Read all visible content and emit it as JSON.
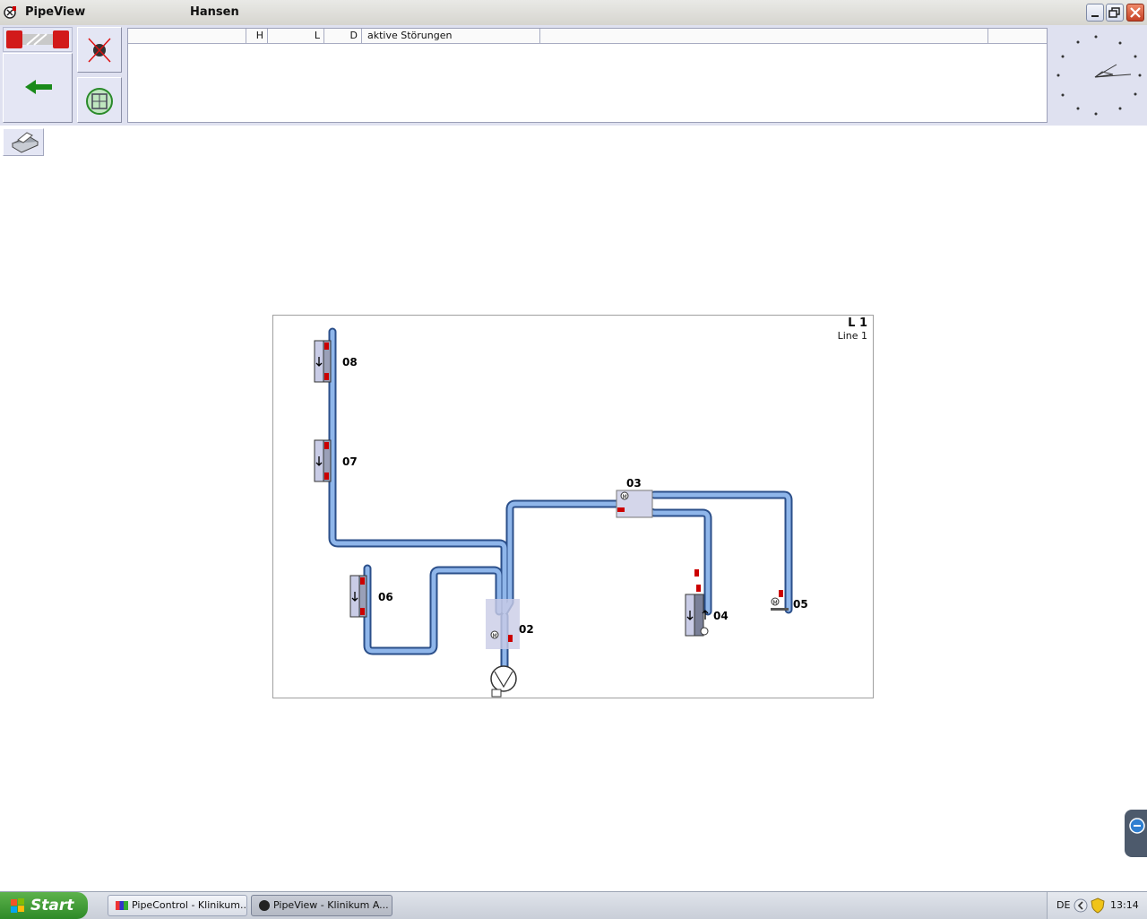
{
  "window": {
    "app_title": "PipeView",
    "user": "Hansen"
  },
  "messages": {
    "columns": [
      "H",
      "L",
      "D",
      "aktive Störungen"
    ]
  },
  "diagram": {
    "line_id": "L 1",
    "line_name": "Line 1",
    "pipe_color": "#8fb6ea",
    "stations": [
      {
        "id": "08",
        "kind": "sender-receiver"
      },
      {
        "id": "07",
        "kind": "sender-receiver"
      },
      {
        "id": "06",
        "kind": "sender-receiver"
      },
      {
        "id": "02",
        "kind": "diverter"
      },
      {
        "id": "03",
        "kind": "diverter"
      },
      {
        "id": "04",
        "kind": "sender-receiver"
      },
      {
        "id": "05",
        "kind": "end-station"
      }
    ]
  },
  "taskbar": {
    "start_label": "Start",
    "tasks": [
      {
        "label": "PipeControl - Klinikum...",
        "active": false
      },
      {
        "label": "PipeView - Klinikum A...",
        "active": true
      }
    ],
    "language": "DE",
    "time": "13:14"
  }
}
